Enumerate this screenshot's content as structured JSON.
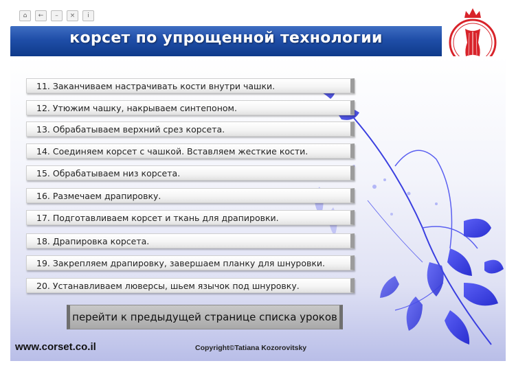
{
  "toolbar": {
    "buttons": [
      {
        "name": "home-icon",
        "glyph": "⌂"
      },
      {
        "name": "back-icon",
        "glyph": "←"
      },
      {
        "name": "minimize-icon",
        "glyph": "–"
      },
      {
        "name": "close-icon",
        "glyph": "×"
      },
      {
        "name": "info-icon",
        "glyph": "i"
      }
    ]
  },
  "header": {
    "title": "корсет по упрощенной технологии"
  },
  "lessons": [
    "11. Заканчиваем настрачивать кости внутри чашки.",
    "12. Утюжим чашку, накрываем синтепоном.",
    "13. Обрабатываем верхний срез корсета.",
    "14. Соединяем корсет с чашкой. Вставляем жесткие кости.",
    "15. Обрабатываем низ корсета.",
    "16. Размечаем драпировку.",
    "17. Подготавливаем корсет и ткань для драпировки.",
    "18. Драпировка корсета.",
    "19. Закрепляем драпировку, завершаем планку для шнуровки.",
    "20. Устанавливаем люверсы, шьем язычок под шнуровку."
  ],
  "prev_button": "перейти к предыдущей странице списка уроков",
  "footer": {
    "url": "www.corset.co.il",
    "copyright": "Copyright©Tatiana Kozorovitsky"
  },
  "colors": {
    "title_bar": "#1f4ea8",
    "logo_red": "#d8232a",
    "flower_blue": "#3a3fe0"
  }
}
